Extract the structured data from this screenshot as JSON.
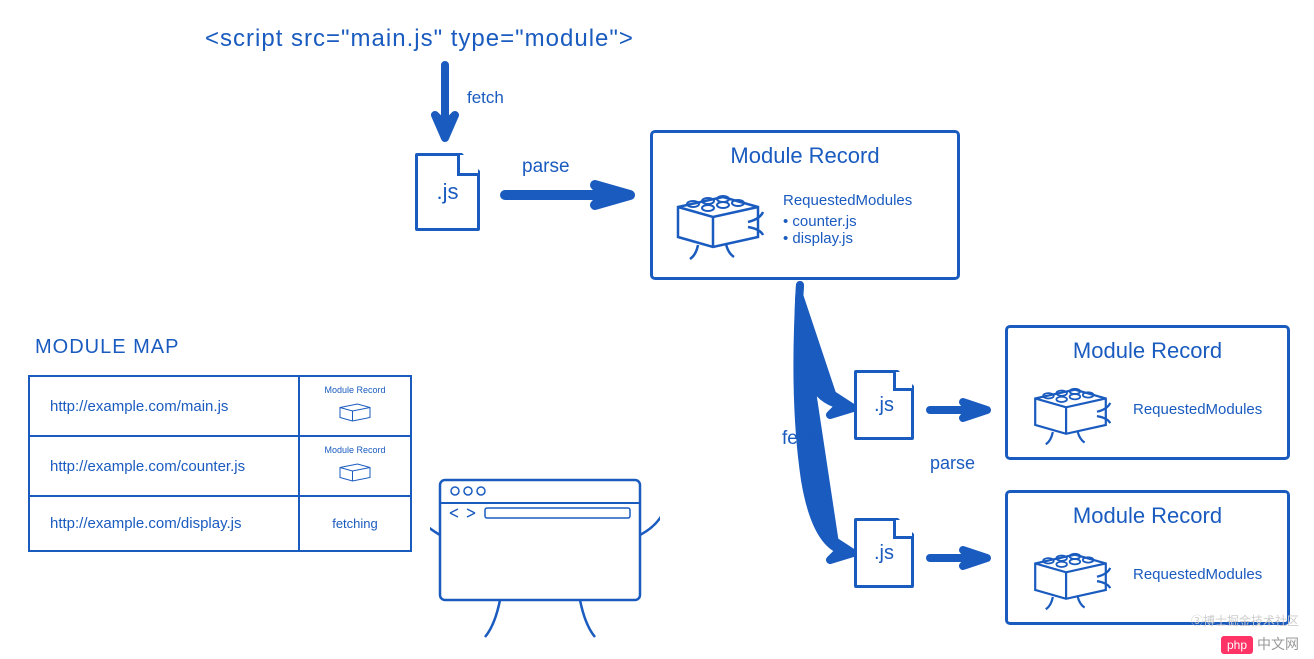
{
  "script_tag": "<script src=\"main.js\" type=\"module\">",
  "labels": {
    "fetch": "fetch",
    "parse": "parse",
    "js": ".js"
  },
  "module_record": {
    "title": "Module Record",
    "requested_modules_label": "RequestedModules",
    "deps_main": [
      "counter.js",
      "display.js"
    ]
  },
  "module_map": {
    "title": "MODULE MAP",
    "rows": [
      {
        "url": "http://example.com/main.js",
        "status": "record"
      },
      {
        "url": "http://example.com/counter.js",
        "status": "record"
      },
      {
        "url": "http://example.com/display.js",
        "status": "fetching"
      }
    ],
    "fetching_label": "fetching",
    "mini_record_label": "Module Record"
  },
  "watermark": "③搏士掘金技术社区",
  "footer": {
    "php_badge": "php",
    "php_text": "中文网"
  }
}
